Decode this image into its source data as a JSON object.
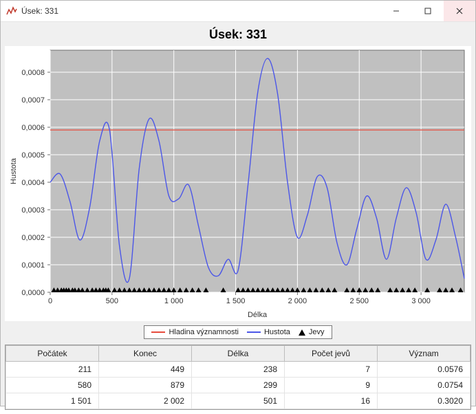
{
  "window": {
    "title": "Úsek: 331"
  },
  "chart": {
    "title": "Úsek: 331",
    "xlabel": "Délka",
    "ylabel": "Hustota"
  },
  "legend": {
    "threshold": "Hladina významnosti",
    "density": "Hustota",
    "events": "Jevy"
  },
  "table": {
    "headers": {
      "start": "Počátek",
      "end": "Konec",
      "length": "Délka",
      "count": "Počet jevů",
      "signif": "Význam"
    },
    "rows": [
      {
        "start": "211",
        "end": "449",
        "length": "238",
        "count": "7",
        "signif": "0.0576"
      },
      {
        "start": "580",
        "end": "879",
        "length": "299",
        "count": "9",
        "signif": "0.0754"
      },
      {
        "start": "1 501",
        "end": "2 002",
        "length": "501",
        "count": "16",
        "signif": "0.3020"
      }
    ]
  },
  "chart_data": {
    "type": "line",
    "title": "Úsek: 331",
    "xlabel": "Délka",
    "ylabel": "Hustota",
    "xlim": [
      0,
      3350
    ],
    "ylim": [
      0,
      0.00088
    ],
    "xticks": [
      0,
      500,
      1000,
      1500,
      2000,
      2500,
      3000
    ],
    "yticks": [
      0.0,
      0.0001,
      0.0002,
      0.0003,
      0.0004,
      0.0005,
      0.0006,
      0.0007,
      0.0008
    ],
    "threshold": 0.00059,
    "series": [
      {
        "name": "Hustota",
        "x": [
          0,
          80,
          160,
          240,
          320,
          400,
          480,
          560,
          640,
          720,
          800,
          880,
          960,
          1040,
          1120,
          1200,
          1280,
          1360,
          1440,
          1520,
          1600,
          1680,
          1760,
          1840,
          1920,
          2000,
          2080,
          2160,
          2240,
          2320,
          2400,
          2480,
          2560,
          2640,
          2720,
          2800,
          2880,
          2960,
          3040,
          3120,
          3200,
          3280,
          3350
        ],
        "y": [
          0.0004,
          0.00043,
          0.00033,
          0.00019,
          0.00031,
          0.00055,
          0.00059,
          0.00017,
          5e-05,
          0.00045,
          0.00063,
          0.00055,
          0.00035,
          0.00034,
          0.00039,
          0.00024,
          9e-05,
          6e-05,
          0.00012,
          8e-05,
          0.00039,
          0.00073,
          0.00085,
          0.00072,
          0.0004,
          0.0002,
          0.00028,
          0.00042,
          0.00038,
          0.00018,
          0.0001,
          0.00023,
          0.00035,
          0.00027,
          0.00012,
          0.00027,
          0.00038,
          0.00029,
          0.00012,
          0.00019,
          0.00032,
          0.0002,
          5e-05
        ]
      }
    ],
    "events_x": [
      30,
      60,
      90,
      110,
      130,
      150,
      180,
      200,
      230,
      260,
      300,
      340,
      370,
      400,
      430,
      450,
      470,
      520,
      560,
      600,
      640,
      680,
      720,
      760,
      800,
      840,
      880,
      920,
      960,
      1000,
      1050,
      1100,
      1150,
      1200,
      1260,
      1400,
      1520,
      1560,
      1600,
      1640,
      1680,
      1720,
      1760,
      1800,
      1840,
      1880,
      1920,
      1960,
      2000,
      2050,
      2100,
      2150,
      2200,
      2250,
      2300,
      2400,
      2450,
      2500,
      2550,
      2600,
      2650,
      2750,
      2800,
      2850,
      2900,
      2950,
      3050,
      3150,
      3200,
      3250,
      3320
    ]
  }
}
